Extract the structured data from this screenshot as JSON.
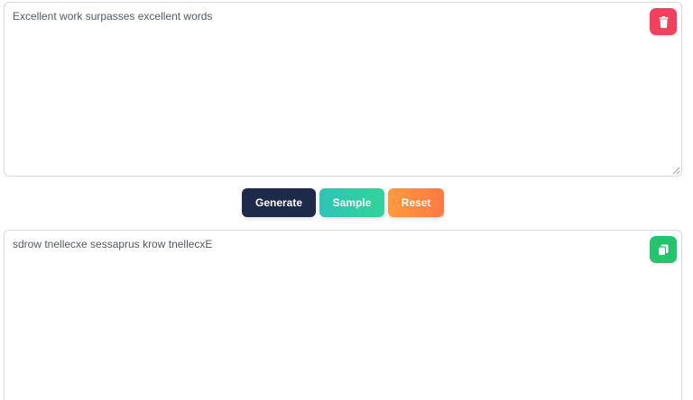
{
  "input": {
    "text": "Excellent work surpasses excellent words",
    "delete_icon": "trash-icon",
    "delete_color": "#f43f5e"
  },
  "buttons": {
    "generate_label": "Generate",
    "sample_label": "Sample",
    "reset_label": "Reset",
    "generate_color": "#1e2a4a",
    "sample_color": "#2ec4b6",
    "reset_color": "#ff8a40"
  },
  "output": {
    "text": "sdrow tnellecxe sessaprus krow tnellecxE",
    "copy_icon": "copy-icon",
    "copy_color": "#22c56e"
  }
}
